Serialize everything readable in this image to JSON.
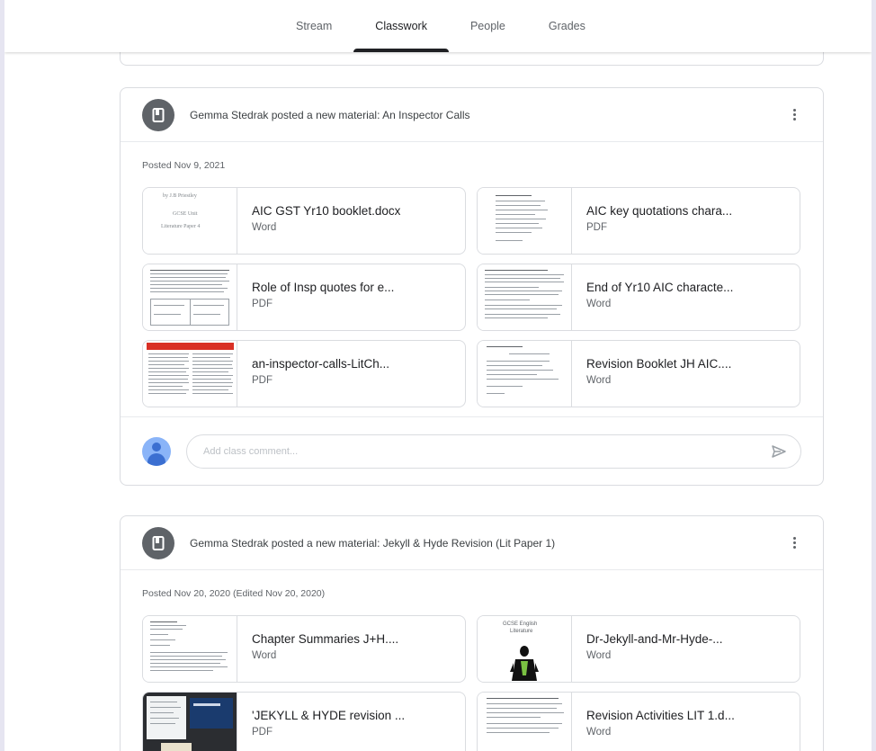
{
  "tabs": [
    {
      "label": "Stream",
      "active": false
    },
    {
      "label": "Classwork",
      "active": true
    },
    {
      "label": "People",
      "active": false
    },
    {
      "label": "Grades",
      "active": false
    }
  ],
  "posts": [
    {
      "title": "Gemma Stedrak posted a new material: An Inspector Calls",
      "posted": "Posted Nov 9, 2021",
      "icon": "material-icon",
      "attachments": [
        {
          "name": "AIC GST Yr10 booklet.docx",
          "type": "Word",
          "thumb": [
            "by J.B Priestley",
            "GCSE Unit",
            "Literature Paper 4"
          ]
        },
        {
          "name": "AIC key quotations chara...",
          "type": "PDF"
        },
        {
          "name": "Role of Insp quotes for e...",
          "type": "PDF"
        },
        {
          "name": "End of Yr10 AIC characte...",
          "type": "Word"
        },
        {
          "name": "an-inspector-calls-LitCh...",
          "type": "PDF"
        },
        {
          "name": "Revision Booklet JH AIC....",
          "type": "Word"
        }
      ],
      "comment_placeholder": "Add class comment..."
    },
    {
      "title": "Gemma Stedrak posted a new material: Jekyll & Hyde Revision (Lit Paper 1)",
      "posted": "Posted Nov 20, 2020 (Edited Nov 20, 2020)",
      "icon": "material-icon",
      "attachments": [
        {
          "name": "Chapter Summaries J+H....",
          "type": "Word"
        },
        {
          "name": "Dr-Jekyll-and-Mr-Hyde-...",
          "type": "Word",
          "thumb": [
            "GCSE English",
            "Literature"
          ]
        },
        {
          "name": "'JEKYLL & HYDE revision ...",
          "type": "PDF"
        },
        {
          "name": "Revision Activities LIT 1.d...",
          "type": "Word"
        }
      ]
    }
  ],
  "colors": {
    "page_bg": "#e6e5f1",
    "accent": "#202124",
    "avatar": "#5f6368",
    "user_avatar": "#8ab4f8"
  }
}
